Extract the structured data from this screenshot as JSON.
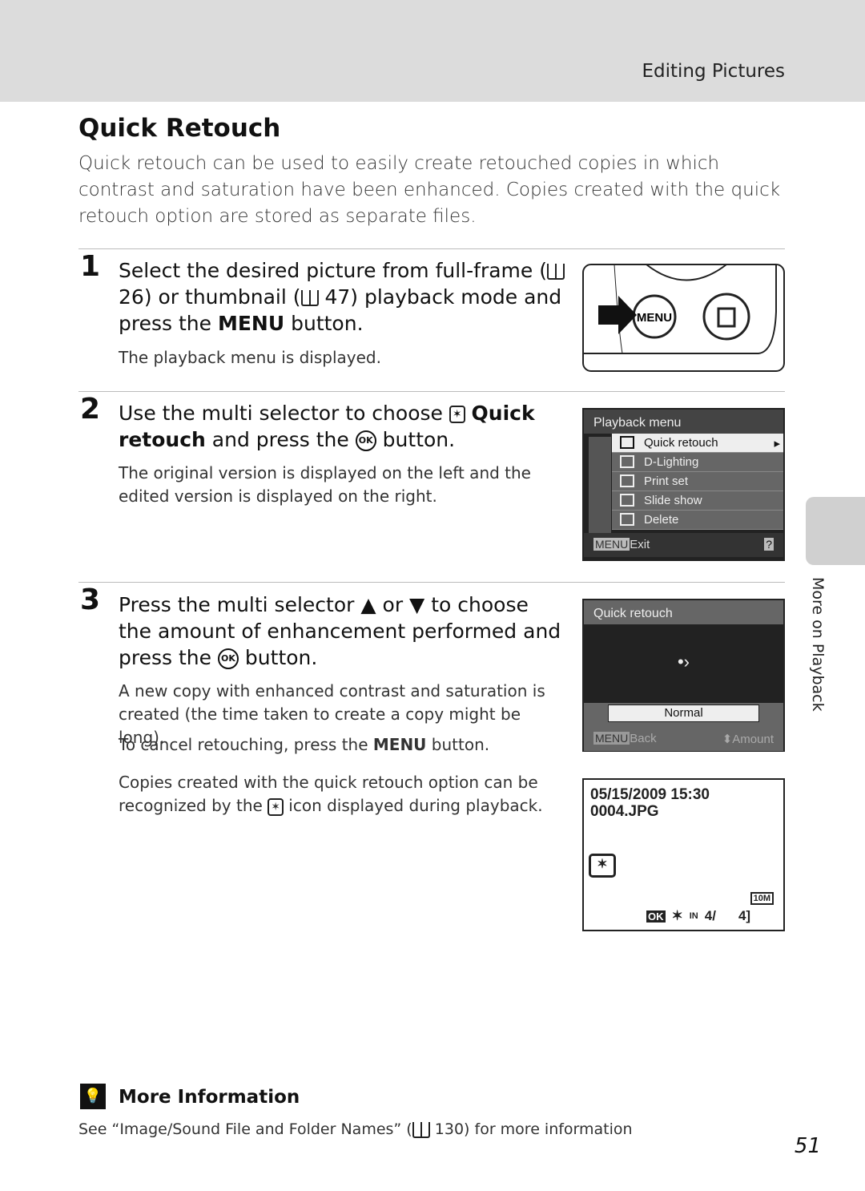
{
  "header": {
    "section": "Editing Pictures"
  },
  "title": "Quick Retouch",
  "intro": "Quick retouch can be used to easily create retouched copies in which contrast and saturation have been enhanced. Copies created with the quick retouch option are stored as separate files.",
  "steps": [
    {
      "number": "1",
      "text_a": "Select the desired picture from full-frame (",
      "ref1": "26",
      "text_b": ") or thumbnail (",
      "ref2": "47",
      "text_c": ") playback mode and press the",
      "menu": "MENU",
      "text_d": "button.",
      "note": "The playback menu is displayed."
    },
    {
      "number": "2",
      "text_a": "Use the multi selector to choose",
      "bold": "Quick retouch",
      "text_b": "and press the",
      "ok": "OK",
      "text_c": "button.",
      "note": "The original version is displayed on the left and the edited version is displayed on the right."
    },
    {
      "number": "3",
      "text_a": "Press the multi selector ▲ or ▼ to choose the amount of enhancement performed and press the",
      "ok": "OK",
      "text_b": "button.",
      "note1": "A new copy with enhanced contrast and saturation is created (the time taken to create a copy might be long).",
      "note2_a": "To cancel retouching, press the",
      "menu": "MENU",
      "note2_b": "button.",
      "note3_a": "Copies created with the quick retouch option can be recognized by the",
      "note3_b": "icon displayed during playback."
    }
  ],
  "camera": {
    "menu_label": "MENU"
  },
  "playback_menu": {
    "title": "Playback menu",
    "items": [
      "Quick retouch",
      "D-Lighting",
      "Print set",
      "Slide show",
      "Delete"
    ],
    "exit_key": "MENU",
    "exit": "Exit",
    "help": "?"
  },
  "quick_retouch_screen": {
    "title": "Quick retouch",
    "value": "Normal",
    "back_key": "MENU",
    "back": "Back",
    "amount": "Amount"
  },
  "playback_screen": {
    "datetime": "05/15/2009 15:30",
    "filename": "0004.JPG",
    "ok": "OK",
    "memory": "IN",
    "counter_a": "4/",
    "counter_b": "4]",
    "size": "10M"
  },
  "more_info": {
    "title": "More Information",
    "text_a": "See “Image/Sound File and Folder Names” (",
    "ref": "130",
    "text_b": ") for more information"
  },
  "side_tab": "More on Playback",
  "page_number": "51"
}
